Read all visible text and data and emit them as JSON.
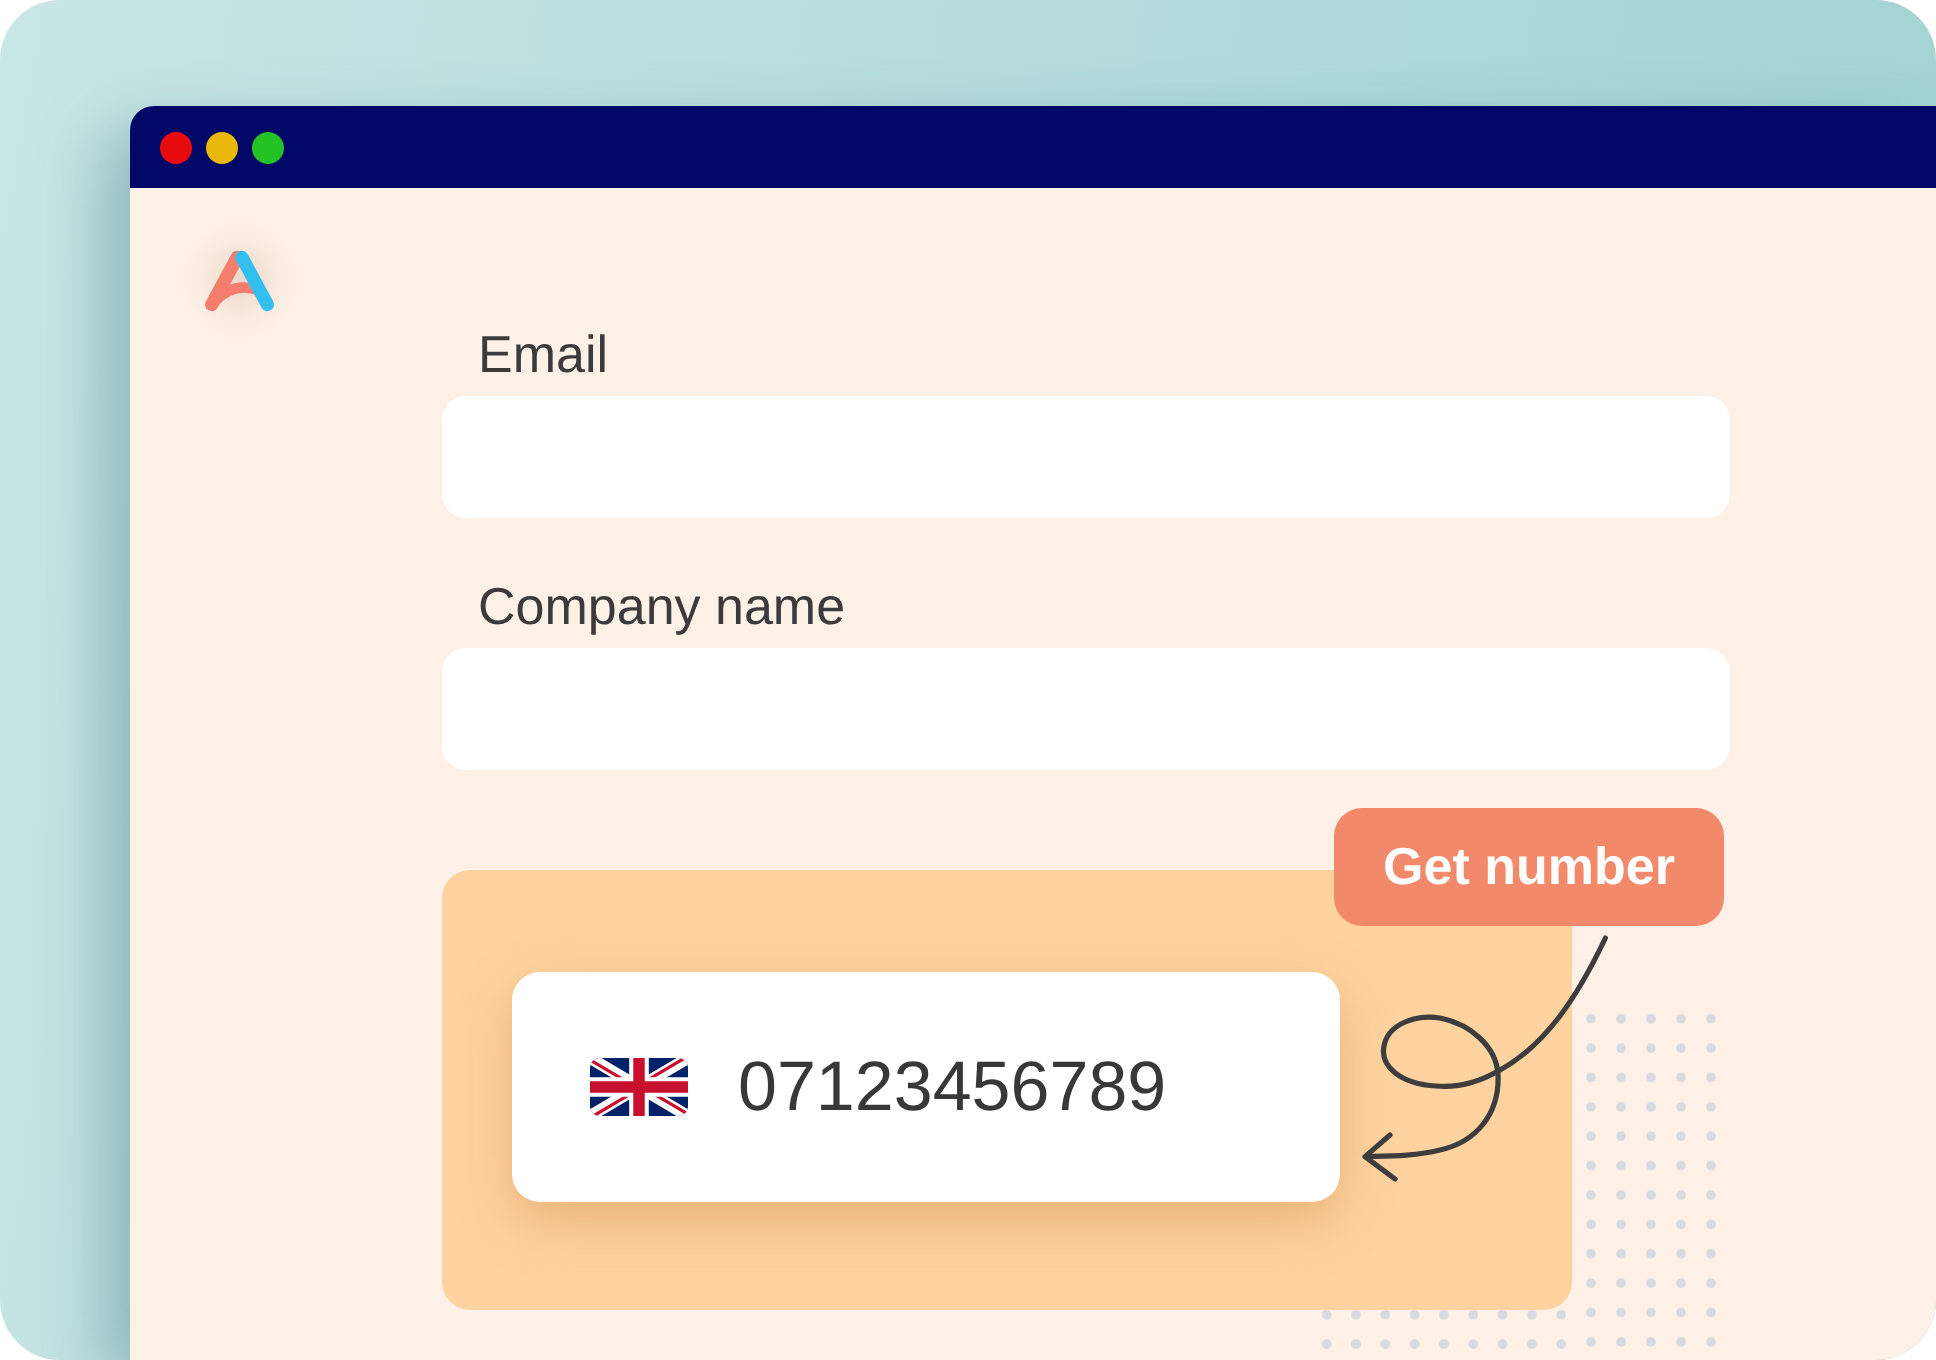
{
  "form": {
    "fields": [
      {
        "label": "Email"
      },
      {
        "label": "Company name"
      }
    ]
  },
  "phone_card": {
    "number": "07123456789"
  },
  "get_number_button": {
    "label": "Get number"
  }
}
